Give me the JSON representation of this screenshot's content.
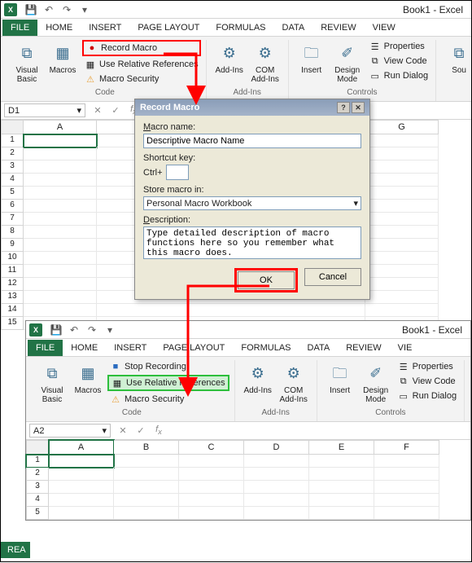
{
  "window1": {
    "title": "Book1 - Excel"
  },
  "tabs": {
    "file": "FILE",
    "home": "HOME",
    "insert": "INSERT",
    "pagelayout": "PAGE LAYOUT",
    "formulas": "FORMULAS",
    "data": "DATA",
    "review": "REVIEW",
    "view": "VIEW",
    "viewshort": "VIE"
  },
  "ribbon1": {
    "visualbasic": "Visual\nBasic",
    "macros": "Macros",
    "record": "Record Macro",
    "userel": "Use Relative References",
    "macrosec": "Macro Security",
    "codegrp": "Code",
    "addins": "Add-Ins",
    "comaddins": "COM\nAdd-Ins",
    "addinsgrp": "Add-Ins",
    "insert": "Insert",
    "design": "Design\nMode",
    "properties": "Properties",
    "viewcode": "View Code",
    "rundialog": "Run Dialog",
    "controlsgrp": "Controls",
    "source": "Sou"
  },
  "ribbon2": {
    "stoprec": "Stop Recording"
  },
  "namebox1": "D1",
  "namebox2": "A2",
  "cols1": [
    "A",
    "G"
  ],
  "cols2": [
    "A",
    "B",
    "C",
    "D",
    "E",
    "F"
  ],
  "dialog": {
    "title": "Record Macro",
    "macroname_lbl": "Macro name:",
    "macroname": "Descriptive Macro Name",
    "shortcut_lbl": "Shortcut key:",
    "ctrl": "Ctrl+",
    "store_lbl": "Store macro in:",
    "store": "Personal Macro Workbook",
    "desc_lbl": "Description:",
    "desc": "Type detailed description of macro functions here so you remember what this macro does.",
    "ok": "OK",
    "cancel": "Cancel"
  },
  "window2": {
    "title": "Book1 - Excel"
  },
  "status": "REA"
}
